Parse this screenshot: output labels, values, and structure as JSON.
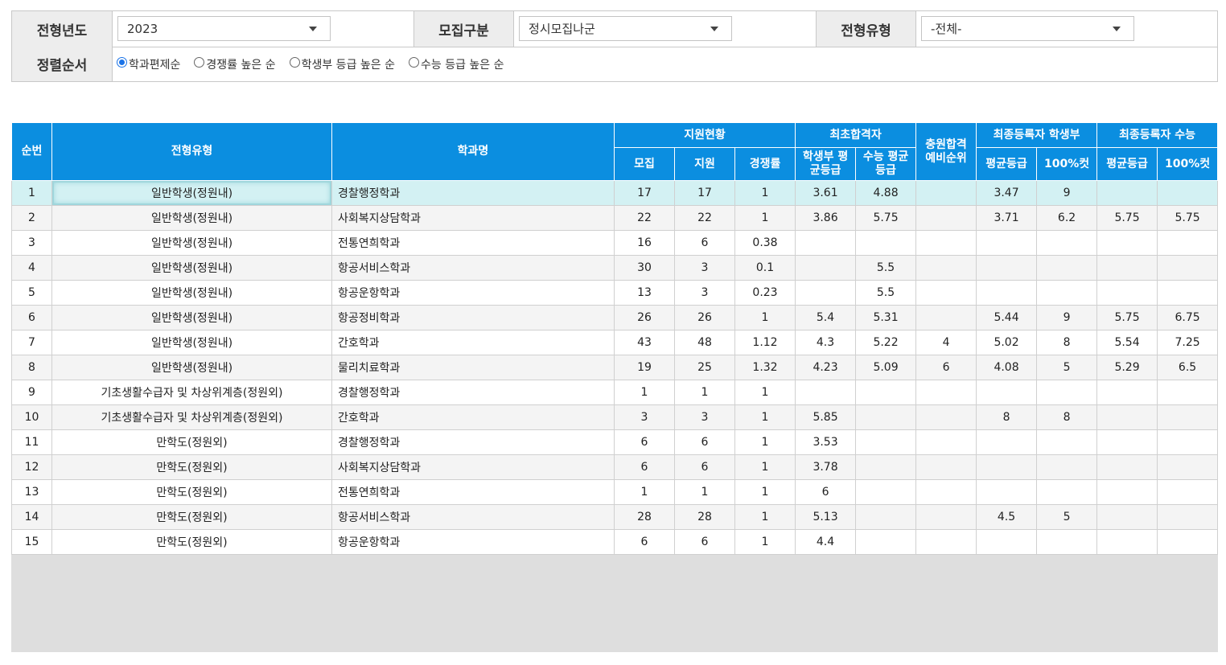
{
  "filters": {
    "year_label": "전형년도",
    "year_value": "2023",
    "recruit_label": "모집구분",
    "recruit_value": "정시모집나군",
    "type_label": "전형유형",
    "type_value": "-전체-",
    "sort_label": "정렬순서",
    "sort_options": [
      {
        "label": "학과편제순",
        "selected": true
      },
      {
        "label": "경쟁률 높은 순",
        "selected": false
      },
      {
        "label": "학생부 등급 높은 순",
        "selected": false
      },
      {
        "label": "수능 등급 높은 순",
        "selected": false
      }
    ]
  },
  "table": {
    "headers": {
      "no": "순번",
      "type": "전형유형",
      "dept": "학과명",
      "apply_group": "지원현황",
      "recruit": "모집",
      "applied": "지원",
      "ratio": "경쟁률",
      "first_group": "최초합격자",
      "first_gpa": "학생부 평균등급",
      "first_csat": "수능 평균등급",
      "waitlist": "충원합격 예비순위",
      "final_gpa_group": "최종등록자 학생부",
      "final_csat_group": "최종등록자 수능",
      "avg_grade": "평균등급",
      "cut100": "100%컷"
    },
    "rows": [
      {
        "no": "1",
        "type": "일반학생(정원내)",
        "dept": "경찰행정학과",
        "recruit": "17",
        "applied": "17",
        "ratio": "1",
        "first_gpa": "3.61",
        "first_csat": "4.88",
        "waitlist": "",
        "final_gpa_avg": "3.47",
        "final_gpa_cut": "9",
        "final_csat_avg": "",
        "final_csat_cut": ""
      },
      {
        "no": "2",
        "type": "일반학생(정원내)",
        "dept": "사회복지상담학과",
        "recruit": "22",
        "applied": "22",
        "ratio": "1",
        "first_gpa": "3.86",
        "first_csat": "5.75",
        "waitlist": "",
        "final_gpa_avg": "3.71",
        "final_gpa_cut": "6.2",
        "final_csat_avg": "5.75",
        "final_csat_cut": "5.75"
      },
      {
        "no": "3",
        "type": "일반학생(정원내)",
        "dept": "전통연희학과",
        "recruit": "16",
        "applied": "6",
        "ratio": "0.38",
        "first_gpa": "",
        "first_csat": "",
        "waitlist": "",
        "final_gpa_avg": "",
        "final_gpa_cut": "",
        "final_csat_avg": "",
        "final_csat_cut": ""
      },
      {
        "no": "4",
        "type": "일반학생(정원내)",
        "dept": "항공서비스학과",
        "recruit": "30",
        "applied": "3",
        "ratio": "0.1",
        "first_gpa": "",
        "first_csat": "5.5",
        "waitlist": "",
        "final_gpa_avg": "",
        "final_gpa_cut": "",
        "final_csat_avg": "",
        "final_csat_cut": ""
      },
      {
        "no": "5",
        "type": "일반학생(정원내)",
        "dept": "항공운항학과",
        "recruit": "13",
        "applied": "3",
        "ratio": "0.23",
        "first_gpa": "",
        "first_csat": "5.5",
        "waitlist": "",
        "final_gpa_avg": "",
        "final_gpa_cut": "",
        "final_csat_avg": "",
        "final_csat_cut": ""
      },
      {
        "no": "6",
        "type": "일반학생(정원내)",
        "dept": "항공정비학과",
        "recruit": "26",
        "applied": "26",
        "ratio": "1",
        "first_gpa": "5.4",
        "first_csat": "5.31",
        "waitlist": "",
        "final_gpa_avg": "5.44",
        "final_gpa_cut": "9",
        "final_csat_avg": "5.75",
        "final_csat_cut": "6.75"
      },
      {
        "no": "7",
        "type": "일반학생(정원내)",
        "dept": "간호학과",
        "recruit": "43",
        "applied": "48",
        "ratio": "1.12",
        "first_gpa": "4.3",
        "first_csat": "5.22",
        "waitlist": "4",
        "final_gpa_avg": "5.02",
        "final_gpa_cut": "8",
        "final_csat_avg": "5.54",
        "final_csat_cut": "7.25"
      },
      {
        "no": "8",
        "type": "일반학생(정원내)",
        "dept": "물리치료학과",
        "recruit": "19",
        "applied": "25",
        "ratio": "1.32",
        "first_gpa": "4.23",
        "first_csat": "5.09",
        "waitlist": "6",
        "final_gpa_avg": "4.08",
        "final_gpa_cut": "5",
        "final_csat_avg": "5.29",
        "final_csat_cut": "6.5"
      },
      {
        "no": "9",
        "type": "기초생활수급자 및 차상위계층(정원외)",
        "dept": "경찰행정학과",
        "recruit": "1",
        "applied": "1",
        "ratio": "1",
        "first_gpa": "",
        "first_csat": "",
        "waitlist": "",
        "final_gpa_avg": "",
        "final_gpa_cut": "",
        "final_csat_avg": "",
        "final_csat_cut": ""
      },
      {
        "no": "10",
        "type": "기초생활수급자 및 차상위계층(정원외)",
        "dept": "간호학과",
        "recruit": "3",
        "applied": "3",
        "ratio": "1",
        "first_gpa": "5.85",
        "first_csat": "",
        "waitlist": "",
        "final_gpa_avg": "8",
        "final_gpa_cut": "8",
        "final_csat_avg": "",
        "final_csat_cut": ""
      },
      {
        "no": "11",
        "type": "만학도(정원외)",
        "dept": "경찰행정학과",
        "recruit": "6",
        "applied": "6",
        "ratio": "1",
        "first_gpa": "3.53",
        "first_csat": "",
        "waitlist": "",
        "final_gpa_avg": "",
        "final_gpa_cut": "",
        "final_csat_avg": "",
        "final_csat_cut": ""
      },
      {
        "no": "12",
        "type": "만학도(정원외)",
        "dept": "사회복지상담학과",
        "recruit": "6",
        "applied": "6",
        "ratio": "1",
        "first_gpa": "3.78",
        "first_csat": "",
        "waitlist": "",
        "final_gpa_avg": "",
        "final_gpa_cut": "",
        "final_csat_avg": "",
        "final_csat_cut": ""
      },
      {
        "no": "13",
        "type": "만학도(정원외)",
        "dept": "전통연희학과",
        "recruit": "1",
        "applied": "1",
        "ratio": "1",
        "first_gpa": "6",
        "first_csat": "",
        "waitlist": "",
        "final_gpa_avg": "",
        "final_gpa_cut": "",
        "final_csat_avg": "",
        "final_csat_cut": ""
      },
      {
        "no": "14",
        "type": "만학도(정원외)",
        "dept": "항공서비스학과",
        "recruit": "28",
        "applied": "28",
        "ratio": "1",
        "first_gpa": "5.13",
        "first_csat": "",
        "waitlist": "",
        "final_gpa_avg": "4.5",
        "final_gpa_cut": "5",
        "final_csat_avg": "",
        "final_csat_cut": ""
      },
      {
        "no": "15",
        "type": "만학도(정원외)",
        "dept": "항공운항학과",
        "recruit": "6",
        "applied": "6",
        "ratio": "1",
        "first_gpa": "4.4",
        "first_csat": "",
        "waitlist": "",
        "final_gpa_avg": "",
        "final_gpa_cut": "",
        "final_csat_avg": "",
        "final_csat_cut": ""
      }
    ]
  },
  "colors": {
    "header_blue": "#0b8ee0",
    "selected_row": "#d3f1f3",
    "label_bg": "#ededed"
  }
}
